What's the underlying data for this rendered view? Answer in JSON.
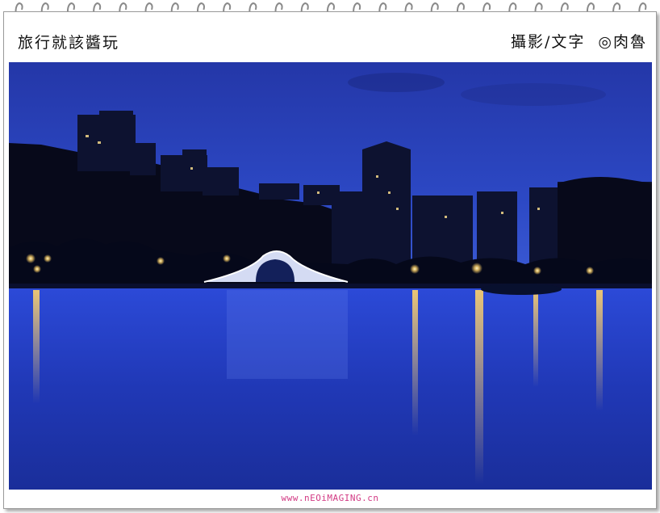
{
  "header": {
    "left_title": "旅行就該醬玩",
    "right_credit": "攝影/文字  ◎肉魯"
  },
  "footer": {
    "watermark": "www.nEOiMAGING.cn"
  },
  "photo": {
    "subject": "night lake with illuminated arched bridge and city skyline",
    "colors": {
      "sky": "#2a3fb0",
      "water": "#1f37b8",
      "lights": "#ffd56b",
      "bridge": "#eaf0ff"
    }
  },
  "binding": {
    "spiral_count": 25
  }
}
